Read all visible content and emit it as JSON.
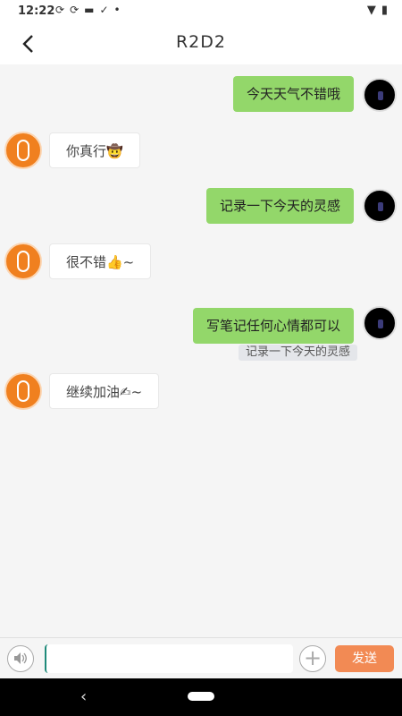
{
  "status_bar": {
    "time": "12:22",
    "left_icons": [
      "sync-icon",
      "sync-icon",
      "message-icon",
      "check-icon",
      "dot-icon"
    ],
    "right_icons": [
      "wifi-icon",
      "battery-icon"
    ]
  },
  "header": {
    "title": "R2D2",
    "back_icon": "back-arrow-icon"
  },
  "messages": [
    {
      "side": "right",
      "text": "今天天气不错哦"
    },
    {
      "side": "left",
      "text": "你真行🤠"
    },
    {
      "side": "right",
      "text": "记录一下今天的灵感"
    },
    {
      "side": "left",
      "text": "很不错👍~"
    },
    {
      "side": "right",
      "text": "写笔记任何心情都可以",
      "tag": "记录一下今天的灵感"
    },
    {
      "side": "left",
      "text": "继续加油✍~"
    }
  ],
  "input_bar": {
    "value": "",
    "voice_icon": "speaker-icon",
    "plus_icon": "plus-icon",
    "send_label": "发送"
  },
  "colors": {
    "right_bubble": "#93d76a",
    "send_button": "#f28a54",
    "left_avatar": "#f0801f"
  }
}
